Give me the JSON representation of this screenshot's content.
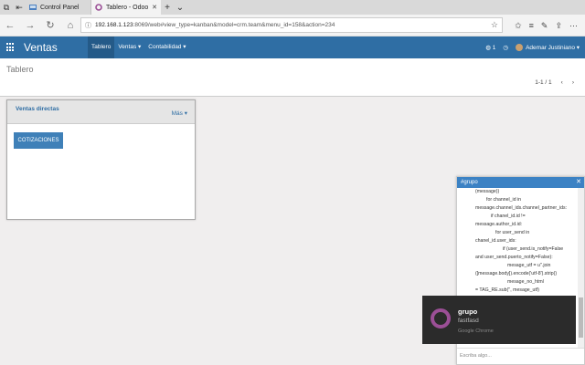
{
  "browser": {
    "tabs": [
      {
        "title": "Control Panel"
      },
      {
        "title": "Tablero - Odoo"
      }
    ],
    "url_host": "192.168.1.123",
    "url_rest": ":8069/web#view_type=kanban&model=crm.team&menu_id=158&action=234"
  },
  "navbar": {
    "brand": "Ventas",
    "menu": [
      "Tablero",
      "Ventas ▾",
      "Contabilidad ▾"
    ],
    "messages_count": "1",
    "user": "Ademar Justiniano ▾"
  },
  "control": {
    "title": "Tablero",
    "pager": "1-1 / 1"
  },
  "dashboard": {
    "title": "Ventas directas",
    "more": "Más ▾",
    "button": "COTIZACIONES"
  },
  "chat": {
    "title": "#grupo",
    "lines": [
      "(message))",
      "for channel_id in",
      "message.channel_ids.channel_partner_ids:",
      "if chanel_id.id !=",
      "message.author_id.id:",
      "for user_send in",
      "chanel_id.user_ids:",
      "if (user_send.is_notify=False",
      "and user_send.puerto_notify=False):",
      "mesage_utf = u''.join",
      "([message.body]).encode('utf-8').strip()",
      "mesage_no_html",
      "= TAG_RE.sub('', mesage_utf)"
    ],
    "last_line": "fastfasd",
    "input_placeholder": "Escriba algo..."
  },
  "toast": {
    "title": "grupo",
    "message": "fastfasd",
    "source": "Google Chrome"
  }
}
